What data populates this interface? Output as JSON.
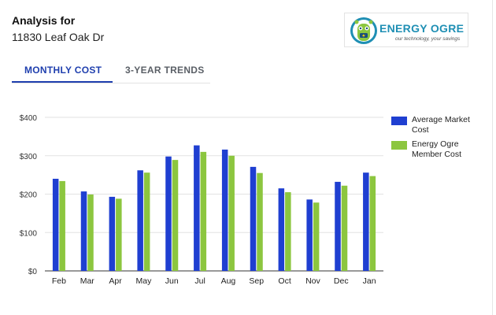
{
  "header": {
    "title": "Analysis for",
    "address": "11830 Leaf Oak Dr"
  },
  "logo": {
    "name": "ENERGY OGRE",
    "tagline": "our technology, your savings",
    "icon": "ogre-mascot-icon"
  },
  "tabs": [
    {
      "label": "MONTHLY COST",
      "active": true
    },
    {
      "label": "3-YEAR TRENDS",
      "active": false
    }
  ],
  "colors": {
    "accent": "#1f3fae",
    "average": "#1f3fd1",
    "member": "#8cc63f"
  },
  "chart_data": {
    "type": "bar",
    "categories": [
      "Feb",
      "Mar",
      "Apr",
      "May",
      "Jun",
      "Jul",
      "Aug",
      "Sep",
      "Oct",
      "Nov",
      "Dec",
      "Jan"
    ],
    "series": [
      {
        "name": "Average Market Cost",
        "values": [
          240,
          207,
          193,
          262,
          298,
          327,
          316,
          271,
          215,
          186,
          232,
          256
        ]
      },
      {
        "name": "Energy Ogre Member Cost",
        "values": [
          234,
          199,
          188,
          256,
          289,
          310,
          300,
          255,
          205,
          178,
          222,
          247
        ]
      }
    ],
    "ylim": [
      0,
      400
    ],
    "yticks": [
      0,
      100,
      200,
      300,
      400
    ],
    "ytick_labels": [
      "$0",
      "$100",
      "$200",
      "$300",
      "$400"
    ],
    "grid": true,
    "legend_position": "right"
  }
}
